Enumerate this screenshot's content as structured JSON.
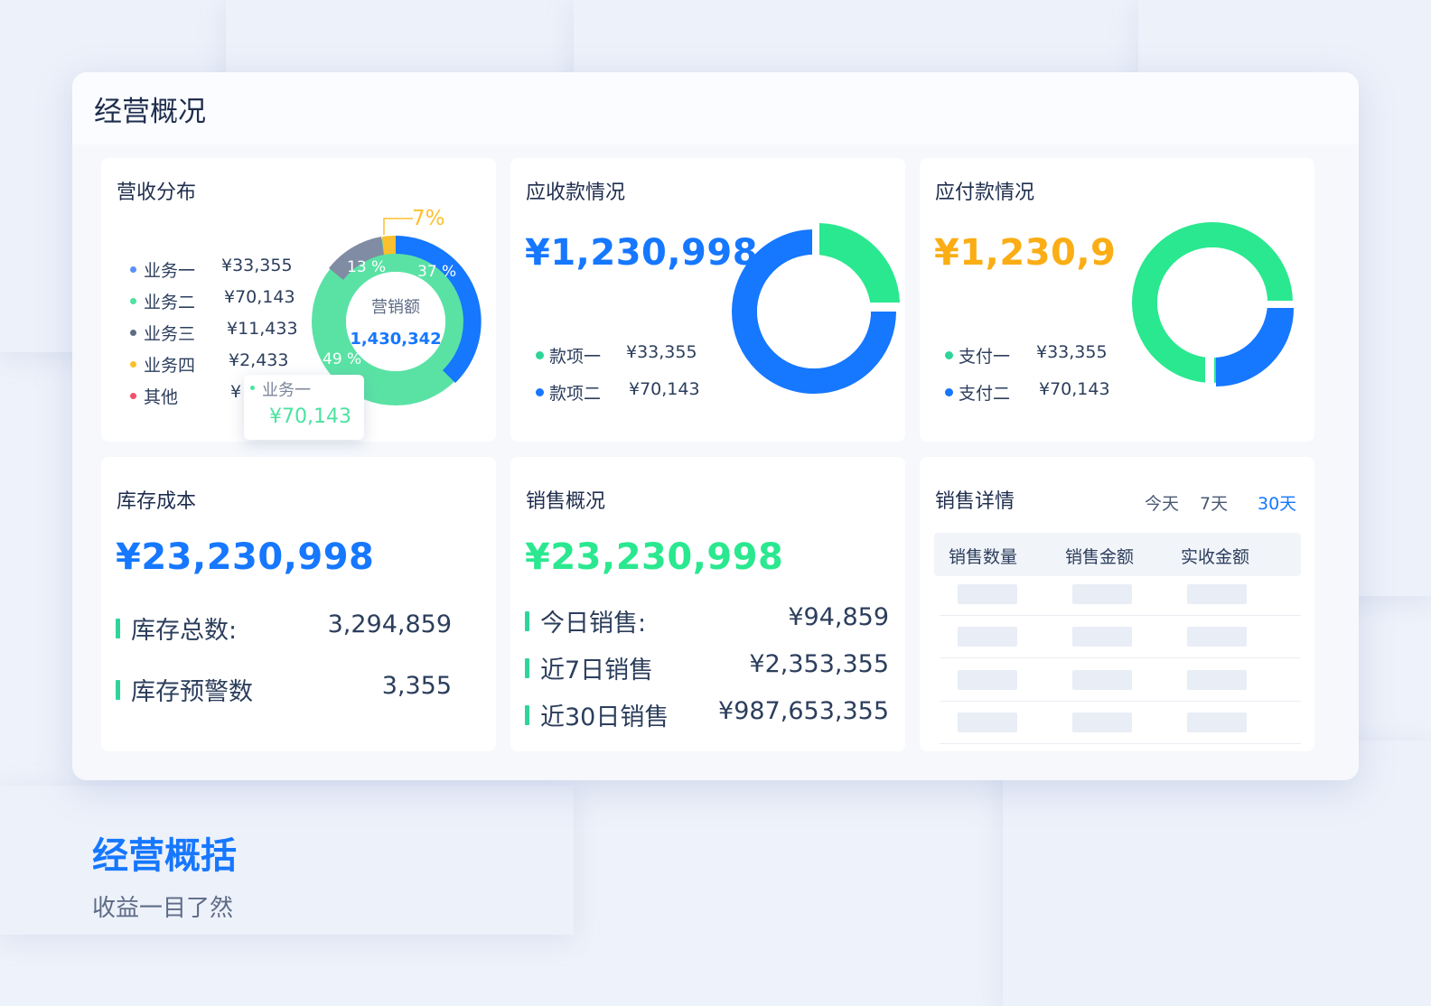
{
  "main": {
    "title": "经营概况"
  },
  "revenue": {
    "title": "营收分布",
    "items": [
      {
        "label": "业务一",
        "value": "¥33,355",
        "color": "#5b8ff9"
      },
      {
        "label": "业务二",
        "value": "¥70,143",
        "color": "#4be3a0"
      },
      {
        "label": "业务三",
        "value": "¥11,433",
        "color": "#5d6b85"
      },
      {
        "label": "业务四",
        "value": "¥2,433",
        "color": "#fbc02d"
      },
      {
        "label": "其他",
        "value": "¥",
        "color": "#f4506b"
      }
    ],
    "donut_center_label": "营销额",
    "donut_center_value": "1,430,342",
    "pct_labels": {
      "blue": "37 %",
      "green": "49 %",
      "gray": "13 %",
      "yellow": "7%"
    },
    "tooltip": {
      "label": "业务一",
      "value": "¥70,143"
    }
  },
  "receivable": {
    "title": "应收款情况",
    "amount": "¥1,230,998",
    "items": [
      {
        "label": "款项一",
        "value": "¥33,355",
        "color": "#2fd598"
      },
      {
        "label": "款项二",
        "value": "¥70,143",
        "color": "#1677ff"
      }
    ]
  },
  "payable": {
    "title": "应付款情况",
    "amount": "¥1,230,9",
    "items": [
      {
        "label": "支付一",
        "value": "¥33,355",
        "color": "#2fd598"
      },
      {
        "label": "支付二",
        "value": "¥70,143",
        "color": "#1677ff"
      }
    ]
  },
  "inventory": {
    "title": "库存成本",
    "amount": "¥23,230,998",
    "rows": [
      {
        "label": "库存总数:",
        "value": "3,294,859"
      },
      {
        "label": "库存预警数",
        "value": "3,355"
      }
    ]
  },
  "sales": {
    "title": "销售概况",
    "amount": "¥23,230,998",
    "rows": [
      {
        "label": "今日销售:",
        "value": "¥94,859"
      },
      {
        "label": "近7日销售",
        "value": "¥2,353,355"
      },
      {
        "label": "近30日销售",
        "value": "¥987,653,355"
      }
    ]
  },
  "sales_detail": {
    "title": "销售详情",
    "tabs": [
      "今天",
      "7天",
      "30天"
    ],
    "active_tab": "30天",
    "columns": [
      "销售数量",
      "销售金额",
      "实收金额"
    ]
  },
  "footer": {
    "title": "经营概括",
    "subtitle": "收益一目了然"
  },
  "colors": {
    "blue": "#1677ff",
    "green": "#2ae88f",
    "amber": "#faad14",
    "gray": "#808ca3"
  }
}
